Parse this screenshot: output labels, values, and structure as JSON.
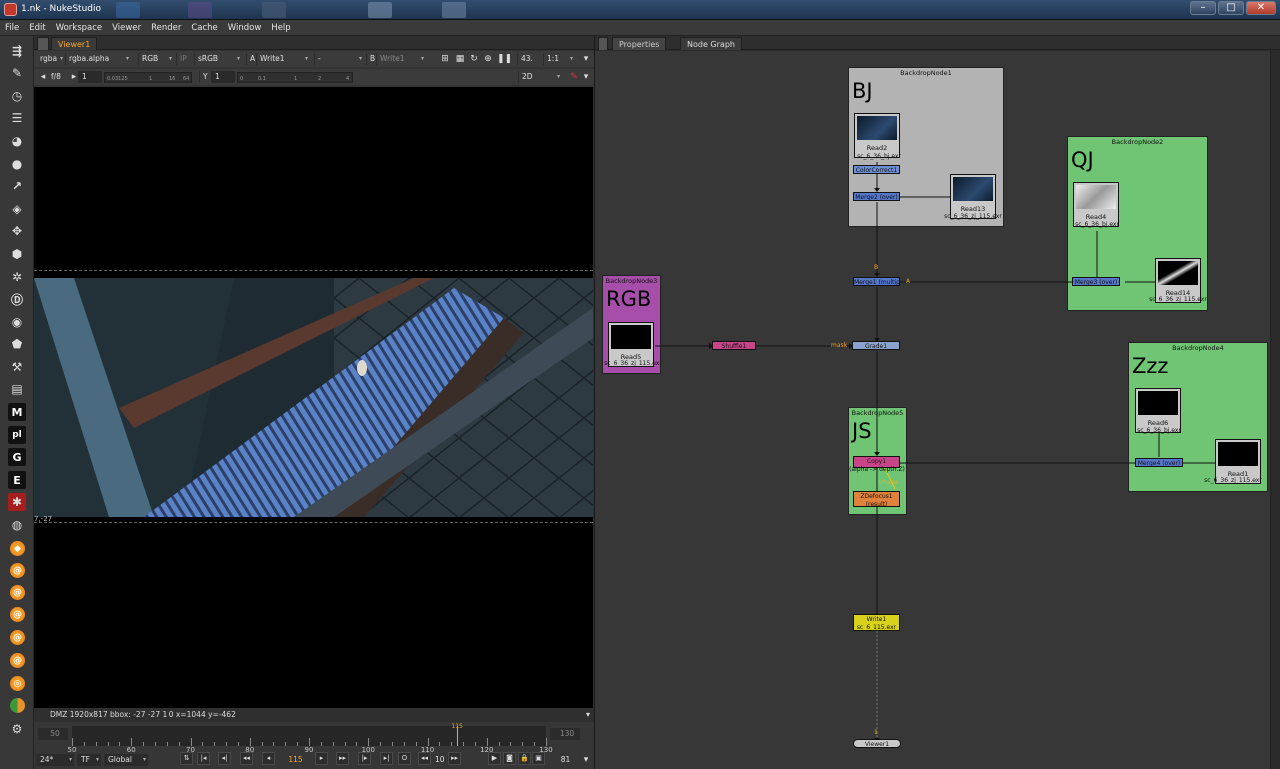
{
  "window": {
    "title": "1.nk - NukeStudio",
    "controls": [
      "–",
      "□",
      "✕"
    ]
  },
  "menu": [
    "File",
    "Edit",
    "Workspace",
    "Viewer",
    "Render",
    "Cache",
    "Window",
    "Help"
  ],
  "toolbar": {
    "icons": [
      "cursor-icon",
      "brush-icon",
      "clock-icon",
      "layers-icon",
      "color-wheel-icon",
      "circle-icon",
      "curve-icon",
      "stack-icon",
      "transform-icon",
      "cube-icon",
      "particles-icon",
      "deep-icon",
      "eye-icon",
      "tag-icon",
      "wrench-icon",
      "film-icon",
      "m-icon",
      "pl-icon",
      "g-icon",
      "e-icon",
      "red-icon",
      "o-icon",
      "flame-icon",
      "swirl-icon",
      "swirl2-icon",
      "swirl3-icon",
      "swirl4-icon",
      "swirl5-icon",
      "swirl6-icon",
      "ball-icon",
      "gear-icon"
    ],
    "letters": {
      "m": "M",
      "pl": "pl",
      "g": "G",
      "e": "E"
    }
  },
  "viewer": {
    "tab": "Viewer1",
    "row1": {
      "channels": "rgba",
      "alpha": "rgba.alpha",
      "display": "RGB",
      "ip": "IP",
      "lut": "sRGB",
      "a_label": "A",
      "a_input": "Write1",
      "dash": "-",
      "b_label": "B",
      "b_input": "Write1",
      "zoom": "43.",
      "ratio": "1:1"
    },
    "row2": {
      "fstop": "f/8",
      "gain": "1",
      "y_label": "Y",
      "gamma": "1",
      "view": "2D"
    },
    "gain_ticks": [
      "0.03125",
      "1",
      "16",
      "64"
    ],
    "gamma_ticks": [
      "0",
      "0.1",
      "1",
      "2",
      "4"
    ],
    "coord_tl": "7,-27",
    "status": "DMZ 1920x817  bbox: -27 -27 1 0  x=1044 y=-462",
    "timeline": {
      "start": "50",
      "end": "130",
      "frame": "115",
      "labels": [
        "50",
        "60",
        "70",
        "80",
        "90",
        "100",
        "110",
        "120",
        "130"
      ],
      "fps": "24*",
      "tf": "TF",
      "mode": "Global",
      "step": "10",
      "current": "115",
      "outpoint": "81"
    }
  },
  "panels": {
    "tabs": [
      "Properties",
      "Node Graph"
    ]
  },
  "nodegraph": {
    "backdrops": [
      {
        "title": "BackdropNode1",
        "label": "BJ"
      },
      {
        "title": "BackdropNode2",
        "label": "QJ"
      },
      {
        "title": "BackdropNode3",
        "label": "RGB"
      },
      {
        "title": "BackdropNode4",
        "label": "Zzz"
      },
      {
        "title": "BackdropNode5",
        "label": "JS"
      }
    ],
    "reads": [
      {
        "name": "Read2",
        "file": "sc_6_36_bj.exr"
      },
      {
        "name": "Read13",
        "file": "sc_6_36_zj_115.exr"
      },
      {
        "name": "Read4",
        "file": "sc_6_36_bj.exr"
      },
      {
        "name": "Read14",
        "file": "sc_6_36_zj_115.exr"
      },
      {
        "name": "Read5",
        "file": "sc_6_36_zj_115.exr"
      },
      {
        "name": "Read6",
        "file": "sc_6_36_bj.exr"
      },
      {
        "name": "Read1",
        "file": "sc_6_36_zj_115.exr"
      }
    ],
    "nodes": {
      "cc": "ColorCorrect1",
      "merge2": "Merge2 (over)",
      "merge1": "Merge1 (multip",
      "merge3": "Merge3 (over)",
      "shuffle": "Shuffle1",
      "grade": "Grade1",
      "copy": "Copy1",
      "copy_sub": "(alpha -> depth.Z)",
      "zdefocus": "ZDefocus1",
      "zdefocus_sub": "(result)",
      "merge4": "Merge4 (over)",
      "write": "Write1",
      "write_sub": "sc_6_115.exr",
      "viewer": "Viewer1"
    },
    "inputs": {
      "b": "B",
      "a": "A",
      "mask": "mask",
      "image": "image",
      "one": "1"
    }
  }
}
